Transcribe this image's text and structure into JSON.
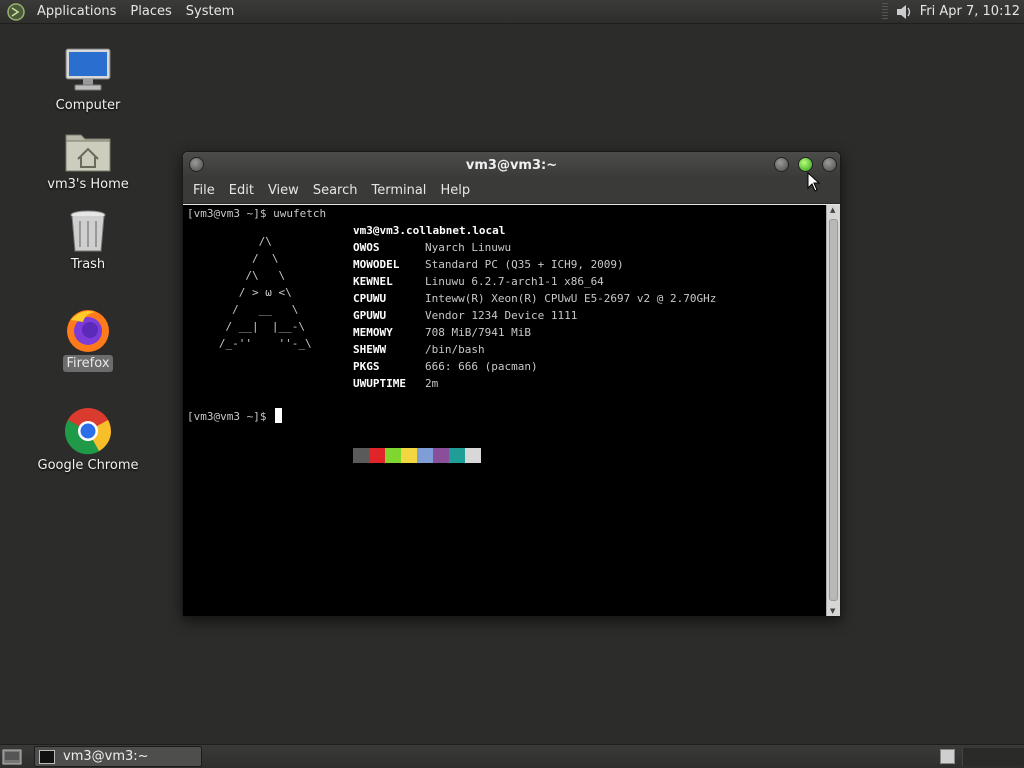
{
  "top_panel": {
    "menus": [
      "Applications",
      "Places",
      "System"
    ],
    "clock": "Fri Apr  7, 10:12"
  },
  "desktop_icons": [
    {
      "name": "computer",
      "label": "Computer"
    },
    {
      "name": "home",
      "label": "vm3's Home"
    },
    {
      "name": "trash",
      "label": "Trash"
    },
    {
      "name": "firefox",
      "label": "Firefox"
    },
    {
      "name": "chrome",
      "label": "Google Chrome"
    }
  ],
  "terminal": {
    "title": "vm3@vm3:~",
    "menu": [
      "File",
      "Edit",
      "View",
      "Search",
      "Terminal",
      "Help"
    ],
    "command_line": "[vm3@vm3 ~]$ uwufetch",
    "ascii_art": "         /\\\n        /  \\\n       /\\   \\\n      / > ω <\\\n     /   __   \\\n    / __|  |__-\\\n   /_-''    ''-_\\",
    "host": "vm3@vm3.collabnet.local",
    "info": [
      {
        "key": "OWOS",
        "value": "Nyarch Linuwu"
      },
      {
        "key": "MOWODEL",
        "value": "Standard PC (Q35 + ICH9, 2009)"
      },
      {
        "key": "KEWNEL",
        "value": "Linuwu 6.2.7-arch1-1 x86_64"
      },
      {
        "key": "CPUWU",
        "value": "Inteww(R) Xeon(R) CPUwU E5-2697 v2 @ 2.70GHz"
      },
      {
        "key": "GPUWU",
        "value": "Vendor 1234 Device 1111"
      },
      {
        "key": "MEMOWY",
        "value": "708 MiB/7941 MiB"
      },
      {
        "key": "SHEWW",
        "value": "/bin/bash"
      },
      {
        "key": "PKGS",
        "value": "666: 666 (pacman)"
      },
      {
        "key": "UWUPTIME",
        "value": "2m"
      }
    ],
    "swatch_colors": [
      "#5a5a5a",
      "#e0242a",
      "#7fd62e",
      "#f2d740",
      "#7f9ed8",
      "#8a4f9a",
      "#1f9e98",
      "#d8d8d8"
    ],
    "prompt": "[vm3@vm3 ~]$ "
  },
  "taskbar": {
    "task_label": "vm3@vm3:~"
  }
}
